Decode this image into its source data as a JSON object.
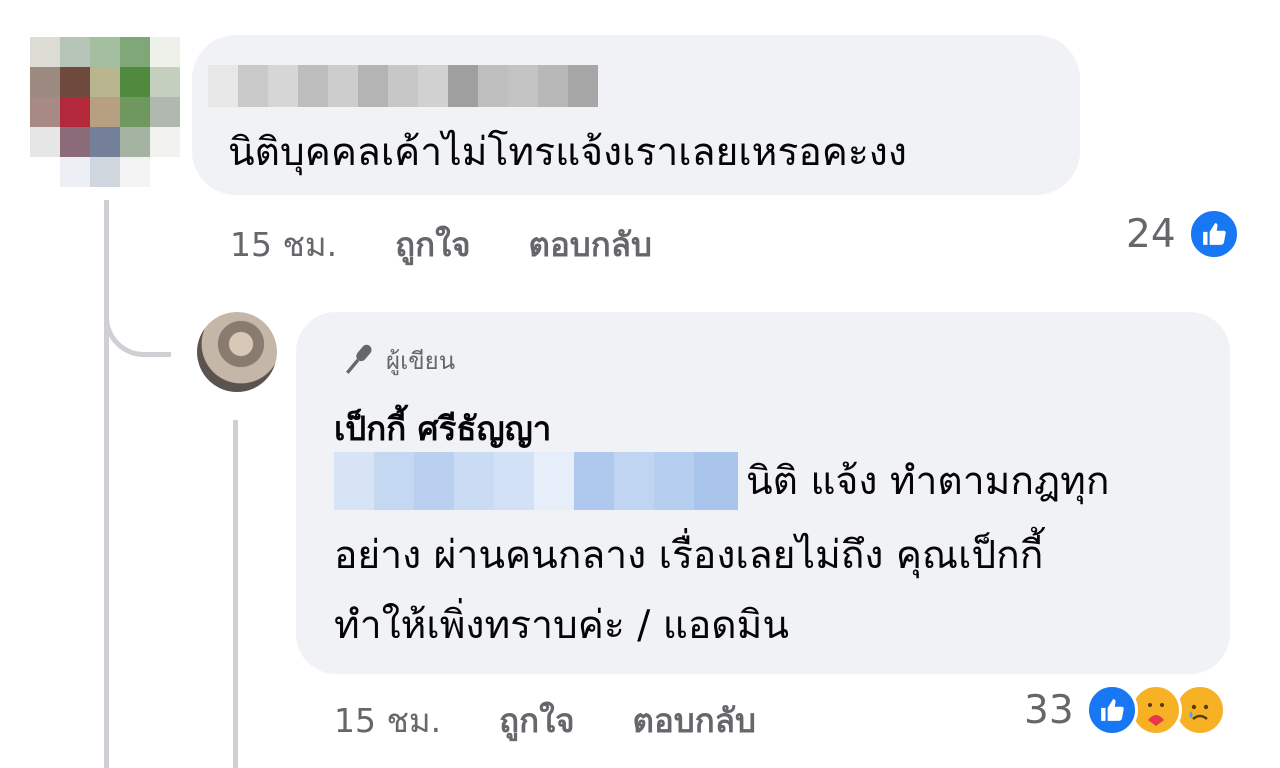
{
  "comment": {
    "text": "นิติบุคคลเค้าไม่โทรแจ้งเราเลยเหรอคะงง",
    "time": "15 ชม.",
    "like_label": "ถูกใจ",
    "reply_label": "ตอบกลับ",
    "reaction_count": "24",
    "reactions": [
      "like-icon"
    ]
  },
  "reply": {
    "badge_label": "ผู้เขียน",
    "author_name": "เป็กกี้ ศรีธัญญา",
    "line1": "นิติ แจ้ง ทำตามกฎทุก",
    "line2": "อย่าง ผ่านคนกลาง เรื่องเลยไม่ถึง คุณเป็กกี้",
    "line3": "ทำให้เพิ่งทราบค่ะ /  แอดมิน",
    "time": "15 ชม.",
    "like_label": "ถูกใจ",
    "reply_label": "ตอบกลับ",
    "reaction_count": "33",
    "reactions": [
      "like-icon",
      "care-icon",
      "sad-icon"
    ]
  },
  "colors": {
    "bubble": "#f0f2f5",
    "meta_text": "#65676b",
    "like_blue": "#1877f2",
    "emoji_yellow": "#f7b125",
    "thread_line": "#ced0d4"
  }
}
